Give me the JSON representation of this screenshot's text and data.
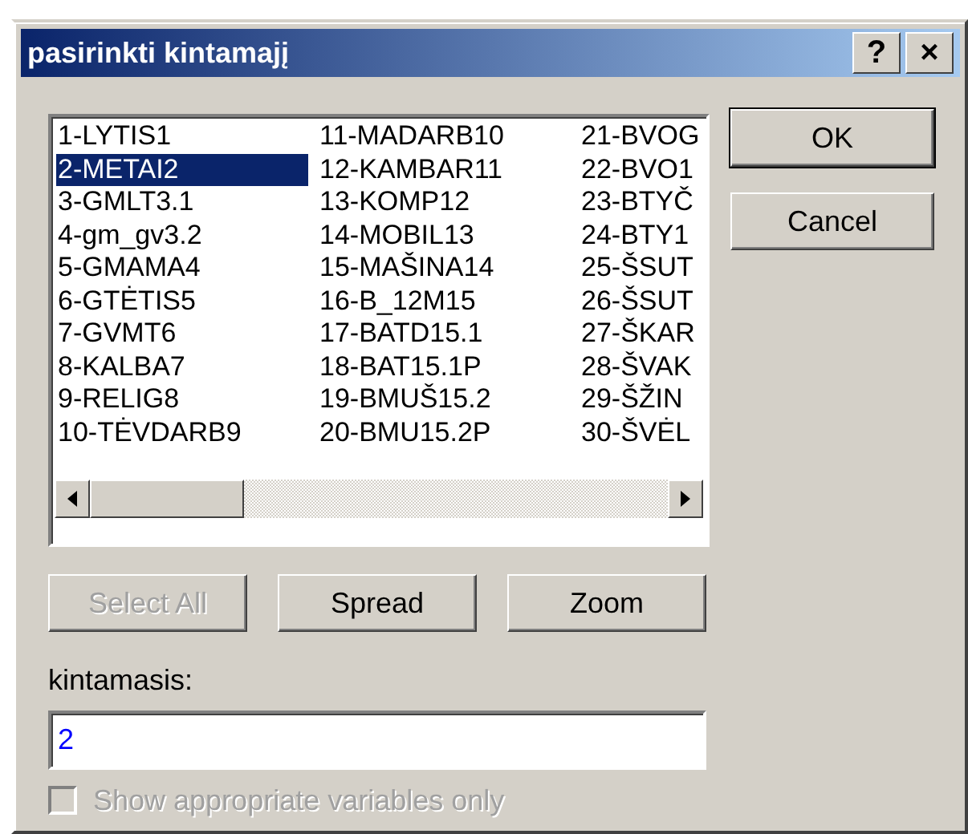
{
  "window": {
    "title": "pasirinkti kintamajį",
    "help_button": "?",
    "close_button": "×"
  },
  "list": {
    "items": [
      {
        "label": "1-LYTIS1",
        "selected": false
      },
      {
        "label": "2-METAI2",
        "selected": true
      },
      {
        "label": "3-GMLT3.1",
        "selected": false
      },
      {
        "label": "4-gm_gv3.2",
        "selected": false
      },
      {
        "label": "5-GMAMA4",
        "selected": false
      },
      {
        "label": "6-GTĖTIS5",
        "selected": false
      },
      {
        "label": "7-GVMT6",
        "selected": false
      },
      {
        "label": "8-KALBA7",
        "selected": false
      },
      {
        "label": "9-RELIG8",
        "selected": false
      },
      {
        "label": "10-TĖVDARB9",
        "selected": false
      },
      {
        "label": "11-MADARB10",
        "selected": false
      },
      {
        "label": "12-KAMBAR11",
        "selected": false
      },
      {
        "label": "13-KOMP12",
        "selected": false
      },
      {
        "label": "14-MOBIL13",
        "selected": false
      },
      {
        "label": "15-MAŠINA14",
        "selected": false
      },
      {
        "label": "16-B_12M15",
        "selected": false
      },
      {
        "label": "17-BATD15.1",
        "selected": false
      },
      {
        "label": "18-BAT15.1P",
        "selected": false
      },
      {
        "label": "19-BMUŠ15.2",
        "selected": false
      },
      {
        "label": "20-BMU15.2P",
        "selected": false
      },
      {
        "label": "21-BVOG",
        "selected": false
      },
      {
        "label": "22-BVO1",
        "selected": false
      },
      {
        "label": "23-BTYČ",
        "selected": false
      },
      {
        "label": "24-BTY1",
        "selected": false
      },
      {
        "label": "25-ŠSUT",
        "selected": false
      },
      {
        "label": "26-ŠSUT",
        "selected": false
      },
      {
        "label": "27-ŠKAR",
        "selected": false
      },
      {
        "label": "28-ŠVAK",
        "selected": false
      },
      {
        "label": "29-ŠŽIN",
        "selected": false
      },
      {
        "label": "30-ŠVĖL",
        "selected": false
      }
    ]
  },
  "buttons": [
    {
      "label": "Select All",
      "disabled": true
    },
    {
      "label": "Spread",
      "disabled": false
    },
    {
      "label": "Zoom",
      "disabled": false
    }
  ],
  "side_buttons": [
    {
      "label": "OK",
      "default": true
    },
    {
      "label": "Cancel",
      "default": false
    }
  ],
  "field": {
    "label": "kintamasis:",
    "value": "2"
  },
  "checkbox": {
    "label": "Show appropriate variables only",
    "checked": false,
    "disabled": true
  }
}
